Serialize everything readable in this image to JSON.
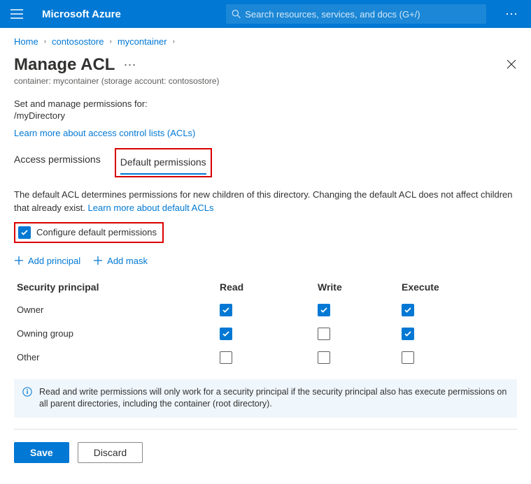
{
  "topbar": {
    "brand": "Microsoft Azure",
    "search_placeholder": "Search resources, services, and docs (G+/)"
  },
  "breadcrumbs": {
    "items": [
      "Home",
      "contosostore",
      "mycontainer"
    ]
  },
  "page": {
    "title": "Manage ACL",
    "subtitle": "container: mycontainer (storage account: contosostore)",
    "lead": "Set and manage permissions for:",
    "path": "/myDirectory",
    "learn_link": "Learn more about access control lists (ACLs)"
  },
  "tabs": {
    "access": "Access permissions",
    "default": "Default permissions"
  },
  "default_section": {
    "description_prefix": "The default ACL determines permissions for new children of this directory. Changing the default ACL does not affect children that already exist. ",
    "description_link": "Learn more about default ACLs",
    "configure_label": "Configure default permissions",
    "configure_checked": true
  },
  "actions": {
    "add_principal": "Add principal",
    "add_mask": "Add mask"
  },
  "table": {
    "headers": {
      "principal": "Security principal",
      "read": "Read",
      "write": "Write",
      "execute": "Execute"
    },
    "rows": [
      {
        "name": "Owner",
        "read": true,
        "write": true,
        "execute": true
      },
      {
        "name": "Owning group",
        "read": true,
        "write": false,
        "execute": true
      },
      {
        "name": "Other",
        "read": false,
        "write": false,
        "execute": false
      }
    ]
  },
  "info": "Read and write permissions will only work for a security principal if the security principal also has execute permissions on all parent directories, including the container (root directory).",
  "buttons": {
    "save": "Save",
    "discard": "Discard"
  }
}
